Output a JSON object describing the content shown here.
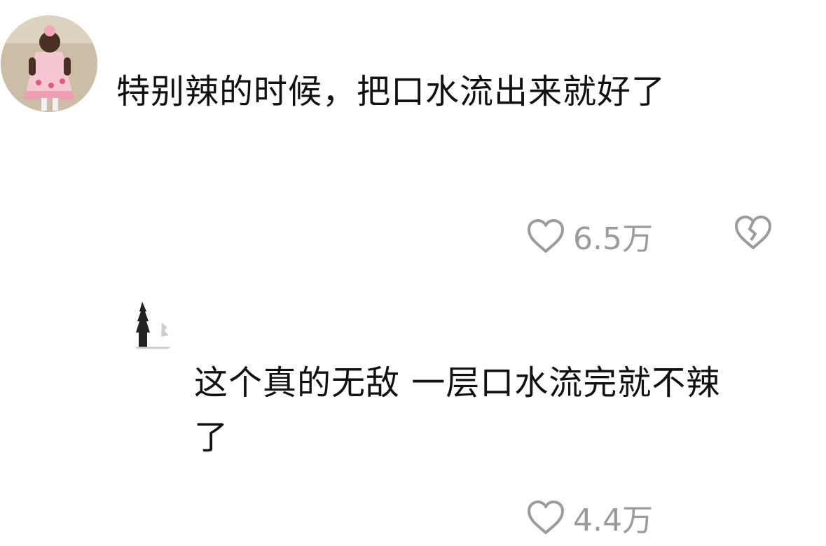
{
  "comments": [
    {
      "avatar_icon": "user-avatar-child-pink-dress",
      "text": "特别辣的时候，把口水流出来就好了",
      "like_icon": "heart-outline-icon",
      "like_count": "6.5万",
      "dislike_icon": "broken-heart-icon"
    },
    {
      "avatar_icon": "user-avatar-tree",
      "text": "这个真的无敌 一层口水流完就不辣了",
      "like_icon": "heart-outline-icon",
      "like_count": "4.4万"
    }
  ],
  "colors": {
    "text": "#111111",
    "muted": "#9b9b9b",
    "background": "#ffffff"
  }
}
